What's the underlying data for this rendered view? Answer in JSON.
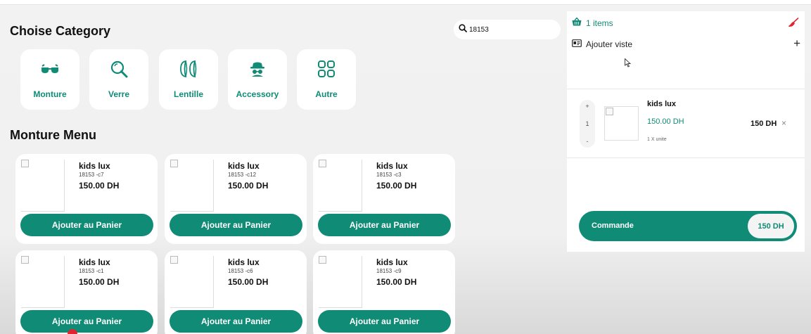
{
  "categories": {
    "title": "Choise Category",
    "items": [
      {
        "label": "Monture",
        "icon": "glasses-icon"
      },
      {
        "label": "Verre",
        "icon": "search-icon"
      },
      {
        "label": "Lentille",
        "icon": "contact-lens-icon"
      },
      {
        "label": "Accessory",
        "icon": "spy-icon"
      },
      {
        "label": "Autre",
        "icon": "grid-icon"
      }
    ]
  },
  "search": {
    "value": "18153",
    "icon": "search-icon"
  },
  "menu": {
    "title": "Monture Menu",
    "add_label": "Ajouter au Panier",
    "products": [
      {
        "name": "kids lux",
        "code": "18153 -c7",
        "price": "150.00 DH"
      },
      {
        "name": "kids lux",
        "code": "18153 -c12",
        "price": "150.00 DH"
      },
      {
        "name": "kids lux",
        "code": "18153 -c3",
        "price": "150.00 DH"
      },
      {
        "name": "kids lux",
        "code": "18153 -c1",
        "price": "150.00 DH"
      },
      {
        "name": "kids lux",
        "code": "18153 -c6",
        "price": "150.00 DH"
      },
      {
        "name": "kids lux",
        "code": "18153 -c9",
        "price": "150.00 DH"
      }
    ]
  },
  "cart": {
    "items_count": "1 items",
    "visit_label": "Ajouter viste",
    "item": {
      "name": "kids lux",
      "price": "150.00 DH",
      "unit": "1 X unite",
      "qty": "1",
      "plus": "+",
      "minus": "-",
      "total": "150 DH",
      "remove": "×"
    },
    "order_label": "Commande",
    "order_total": "150 DH"
  },
  "colors": {
    "accent": "#0f8b76",
    "brush": "#e1242f"
  }
}
